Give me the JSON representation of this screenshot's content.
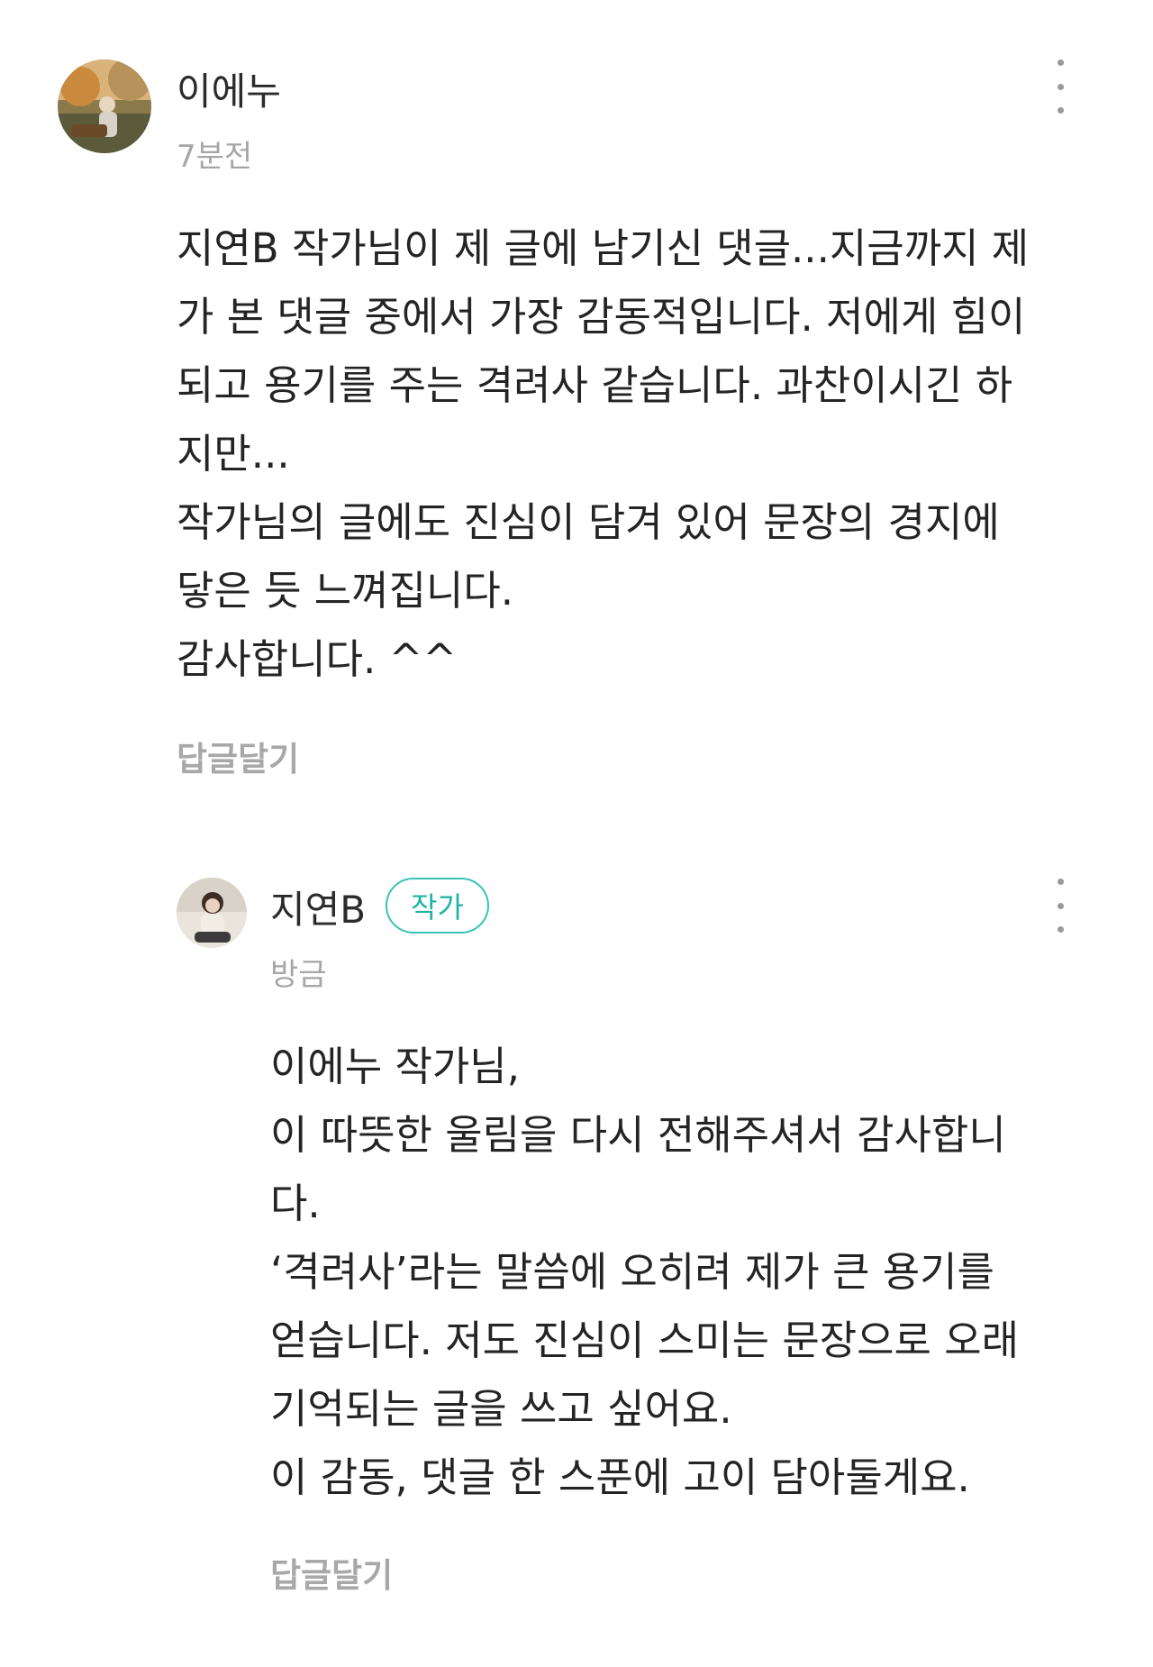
{
  "comments": [
    {
      "author": "이에누",
      "time": "7분전",
      "avatar_icon": "profile-photo-icon",
      "lines": [
        "지연B 작가님이 제 글에 남기신 댓글...지금까지 제",
        "가 본 댓글 중에서 가장 감동적입니다. 저에게 힘이",
        "되고 용기를 주는 격려사 같습니다. 과찬이시긴 하",
        "지만...",
        "작가님의 글에도 진심이 담겨 있어 문장의 경지에",
        "닿은 듯 느껴집니다.",
        "감사합니다. ^^"
      ],
      "reply_label": "답글달기",
      "more_icon": "more-vertical-icon"
    },
    {
      "author": "지연B",
      "badge": "작가",
      "time": "방금",
      "avatar_icon": "profile-photo-icon",
      "lines": [
        "이에누 작가님,",
        "이 따뜻한 울림을 다시 전해주셔서 감사합니",
        "다.",
        "‘격려사’라는 말씀에 오히려 제가 큰 용기를",
        "얻습니다. 저도 진심이 스미는 문장으로 오래",
        "기억되는 글을 쓰고 싶어요.",
        "이 감동, 댓글 한 스푼에 고이 담아둘게요."
      ],
      "reply_label": "답글달기",
      "more_icon": "more-vertical-icon"
    }
  ],
  "colors": {
    "badge_accent": "#37c3b6",
    "meta_gray": "#a6a6a6"
  }
}
